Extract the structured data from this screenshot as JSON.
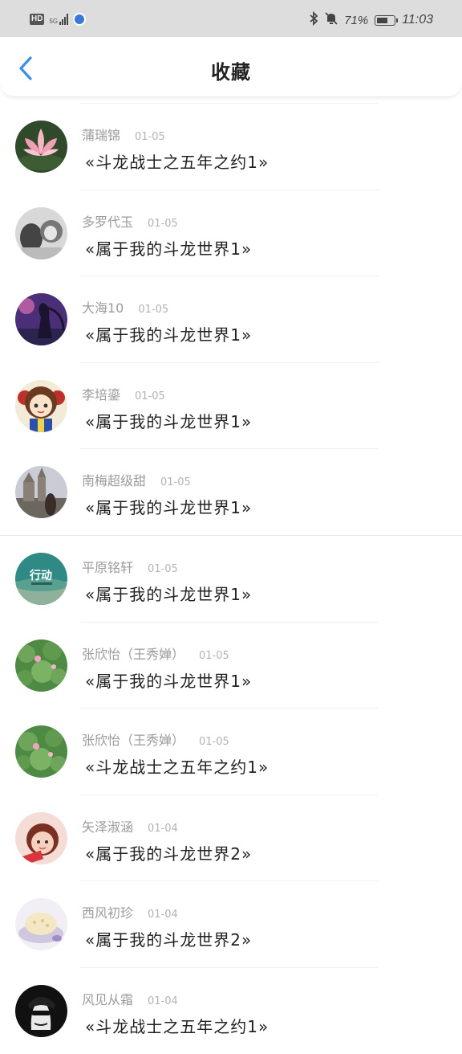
{
  "status_bar": {
    "hd": "HD",
    "network": "5G",
    "battery_percent": "71%",
    "battery_level": 0.71,
    "time": "11:03",
    "icons": [
      "bluetooth-icon",
      "bell-muted-icon"
    ]
  },
  "header": {
    "title": "收藏",
    "back_icon": "chevron-left-icon"
  },
  "colors": {
    "accent": "#3a8ee6",
    "name_text": "#9b9b9b",
    "date_text": "#b3b3b3",
    "book_text": "#222222"
  },
  "favorites": [
    {
      "name": "蒲瑞锦",
      "date": "01-05",
      "book": "«斗龙战士之五年之约1»"
    },
    {
      "name": "多罗代玉",
      "date": "01-05",
      "book": "«属于我的斗龙世界1»"
    },
    {
      "name": "大海10",
      "date": "01-05",
      "book": "«属于我的斗龙世界1»"
    },
    {
      "name": "李培鎏",
      "date": "01-05",
      "book": "«属于我的斗龙世界1»"
    },
    {
      "name": "南梅超级甜",
      "date": "01-05",
      "book": "«属于我的斗龙世界1»"
    },
    {
      "name": "平原铭轩",
      "date": "01-05",
      "book": "«属于我的斗龙世界1»",
      "avatar_text": "行动"
    },
    {
      "name": "张欣怡（王秀婵）",
      "date": "01-05",
      "book": "«属于我的斗龙世界1»"
    },
    {
      "name": "张欣怡（王秀婵）",
      "date": "01-05",
      "book": "«斗龙战士之五年之约1»"
    },
    {
      "name": "矢泽淑涵",
      "date": "01-04",
      "book": "«属于我的斗龙世界2»"
    },
    {
      "name": "西风初珍",
      "date": "01-04",
      "book": "«属于我的斗龙世界2»"
    },
    {
      "name": "风见从霜",
      "date": "01-04",
      "book": "«斗龙战士之五年之约1»"
    }
  ]
}
